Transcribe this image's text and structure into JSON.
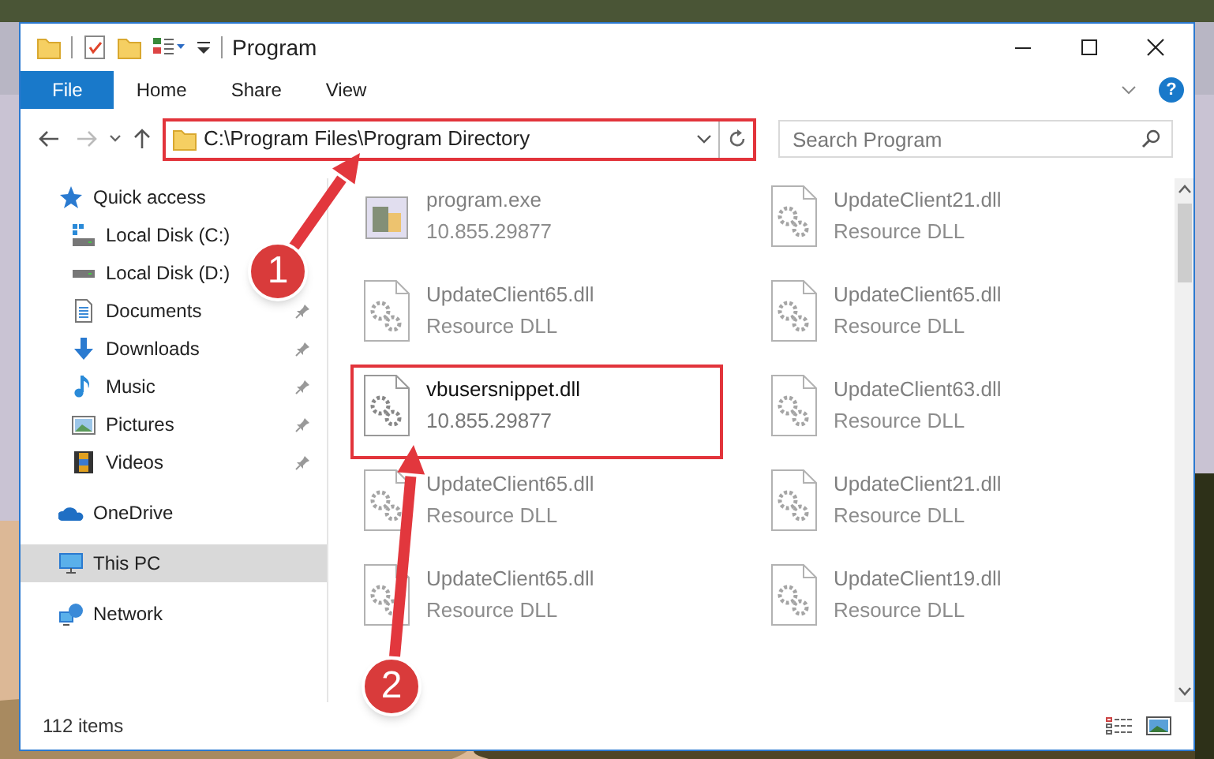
{
  "window": {
    "title": "Program"
  },
  "ribbon": {
    "tabs": [
      {
        "label": "File",
        "selected": true
      },
      {
        "label": "Home",
        "selected": false
      },
      {
        "label": "Share",
        "selected": false
      },
      {
        "label": "View",
        "selected": false
      }
    ],
    "help": "?"
  },
  "address": {
    "path": "C:\\Program Files\\Program Directory",
    "highlighted": true
  },
  "search": {
    "placeholder": "Search Program"
  },
  "sidebar": {
    "items": [
      {
        "label": "Quick access",
        "kind": "quick",
        "selected": false,
        "children": [
          {
            "label": "Local Disk (C:)",
            "kind": "diskc",
            "pinned": false
          },
          {
            "label": "Local Disk (D:)",
            "kind": "disk",
            "pinned": false
          },
          {
            "label": "Documents",
            "kind": "documents",
            "pinned": true
          },
          {
            "label": "Downloads",
            "kind": "downloads",
            "pinned": true
          },
          {
            "label": "Music",
            "kind": "music",
            "pinned": true
          },
          {
            "label": "Pictures",
            "kind": "pictures",
            "pinned": true
          },
          {
            "label": "Videos",
            "kind": "videos",
            "pinned": true
          }
        ]
      },
      {
        "label": "OneDrive",
        "kind": "onedrive",
        "selected": false
      },
      {
        "label": "This PC",
        "kind": "pc",
        "selected": true
      },
      {
        "label": "Network",
        "kind": "network",
        "selected": false
      }
    ]
  },
  "files": [
    {
      "name": "program.exe",
      "detail": "10.855.29877",
      "kind": "exe",
      "blurred": true,
      "highlighted": false
    },
    {
      "name": "UpdateClient21.dll",
      "detail": "Resource DLL",
      "kind": "dll",
      "blurred": true,
      "highlighted": false
    },
    {
      "name": "UpdateClient65.dll",
      "detail": "Resource DLL",
      "kind": "dll",
      "blurred": true,
      "highlighted": false
    },
    {
      "name": "UpdateClient65.dll",
      "detail": "Resource DLL",
      "kind": "dll",
      "blurred": true,
      "highlighted": false
    },
    {
      "name": "vbusersnippet.dll",
      "detail": "10.855.29877",
      "kind": "dll",
      "blurred": false,
      "highlighted": true
    },
    {
      "name": "UpdateClient63.dll",
      "detail": "Resource DLL",
      "kind": "dll",
      "blurred": true,
      "highlighted": false
    },
    {
      "name": "UpdateClient65.dll",
      "detail": "Resource DLL",
      "kind": "dll",
      "blurred": true,
      "highlighted": false
    },
    {
      "name": "UpdateClient21.dll",
      "detail": "Resource DLL",
      "kind": "dll",
      "blurred": true,
      "highlighted": false
    },
    {
      "name": "UpdateClient65.dll",
      "detail": "Resource DLL",
      "kind": "dll",
      "blurred": true,
      "highlighted": false
    },
    {
      "name": "UpdateClient19.dll",
      "detail": "Resource DLL",
      "kind": "dll",
      "blurred": true,
      "highlighted": false
    }
  ],
  "annotations": [
    {
      "label": "1"
    },
    {
      "label": "2"
    }
  ],
  "status_bar": {
    "count": "112 items"
  }
}
